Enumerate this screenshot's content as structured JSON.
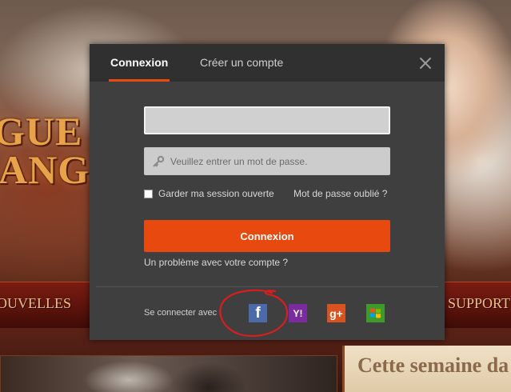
{
  "background": {
    "logo_line1": "GUE",
    "logo_line2": "ANGEL",
    "nav_left": "OUVELLES",
    "nav_right": "SUPPORT",
    "news_title": "Cette semaine da"
  },
  "modal": {
    "tabs": [
      {
        "label": "Connexion",
        "active": true
      },
      {
        "label": "Créer un compte",
        "active": false
      }
    ],
    "username": {
      "value": "",
      "placeholder": ""
    },
    "password": {
      "value": "",
      "placeholder": "Veuillez entrer un mot de passe."
    },
    "remember_label": "Garder ma session ouverte",
    "remember_checked": false,
    "forgot_link": "Mot de passe oublié ?",
    "login_button": "Connexion",
    "problem_link": "Un problème avec votre compte ?",
    "connect_with_label": "Se connecter avec :",
    "social": [
      {
        "name": "facebook",
        "glyph": "f",
        "color": "#4d6aa8"
      },
      {
        "name": "yahoo",
        "glyph": "Y!",
        "color": "#7b2aa0"
      },
      {
        "name": "google-plus",
        "glyph": "g+",
        "color": "#d8531f"
      },
      {
        "name": "windows-live",
        "glyph": "",
        "color": "#3e9a2a"
      }
    ],
    "accent_color": "#e8490f"
  }
}
